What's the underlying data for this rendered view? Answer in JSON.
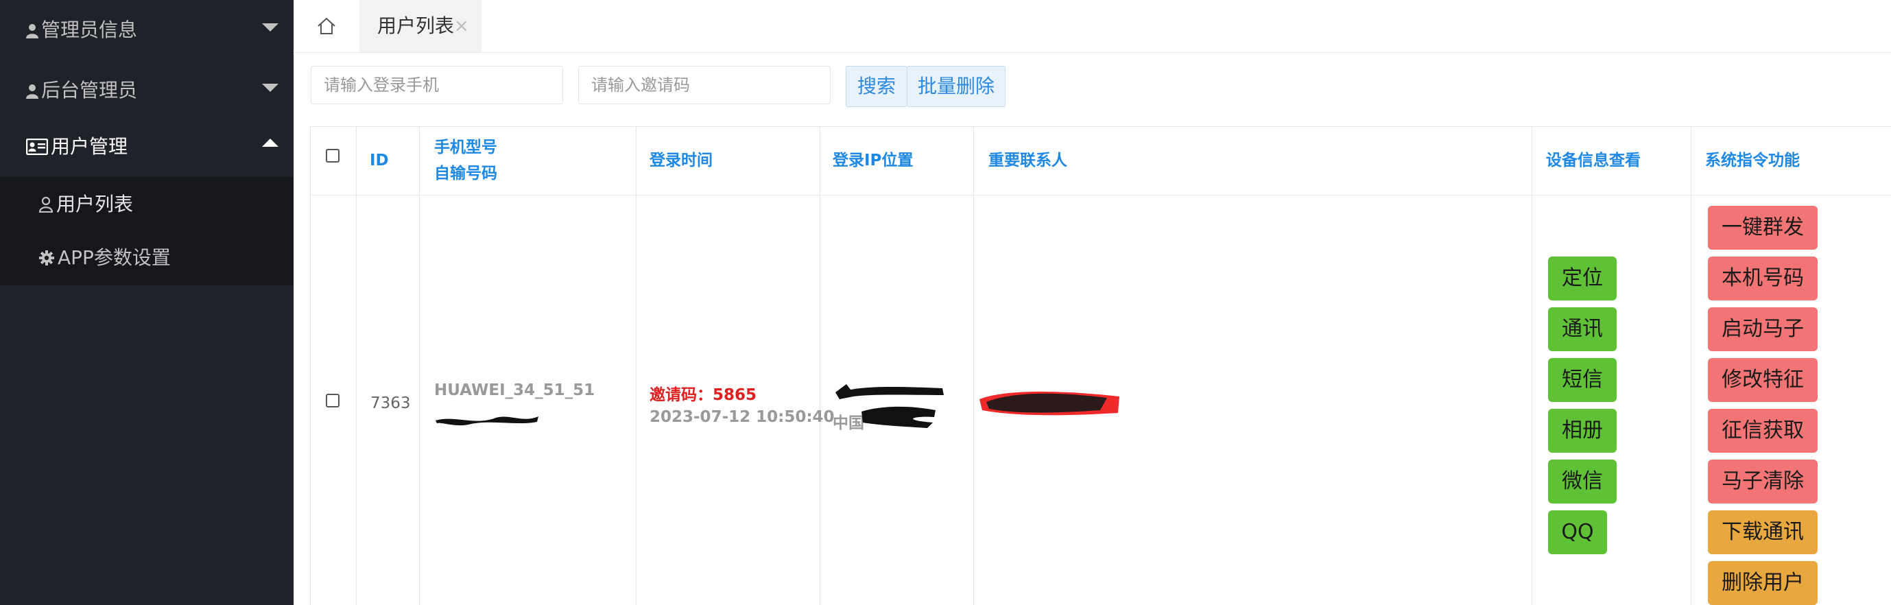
{
  "sidebar": {
    "groups": [
      {
        "label": "管理员信息",
        "icon": "user-icon"
      },
      {
        "label": "后台管理员",
        "icon": "user-icon"
      },
      {
        "label": "用户管理",
        "icon": "id-card-icon"
      }
    ],
    "subitems": [
      {
        "label": "用户列表",
        "icon": "user-outline-icon"
      },
      {
        "label": "APP参数设置",
        "icon": "gear-icon"
      }
    ]
  },
  "tabs": {
    "home_icon": "home-icon",
    "active_label": "用户列表",
    "close_glyph": "×"
  },
  "toolbar": {
    "phone_placeholder": "请输入登录手机",
    "invite_placeholder": "请输入邀请码",
    "search_label": "搜索",
    "batch_delete_label": "批量删除"
  },
  "table": {
    "headers": {
      "id": "ID",
      "model_line1": "手机型号",
      "model_line2": "自输号码",
      "login_time": "登录时间",
      "login_ip": "登录IP位置",
      "contacts": "重要联系人",
      "device_info": "设备信息查看",
      "commands": "系统指令功能"
    },
    "rows": [
      {
        "id": "7363",
        "model": "HUAWEI_34_51_51",
        "invite": "邀请码：5865",
        "time": "2023-07-12 10:50:40",
        "ip_prefix": "中国",
        "device_buttons": [
          "定位",
          "通讯",
          "短信",
          "相册",
          "微信",
          "QQ"
        ],
        "command_buttons": [
          "一键群发",
          "本机号码",
          "启动马子",
          "修改特征",
          "征信获取",
          "马子清除",
          "下载通讯",
          "删除用户"
        ]
      }
    ]
  },
  "colors": {
    "sidebar_bg": "#20222a",
    "header_text": "#1e88e5",
    "green_button": "#5fc236",
    "red_button": "#f37474",
    "orange_button": "#e9a83f",
    "invite_red": "#e02020"
  }
}
